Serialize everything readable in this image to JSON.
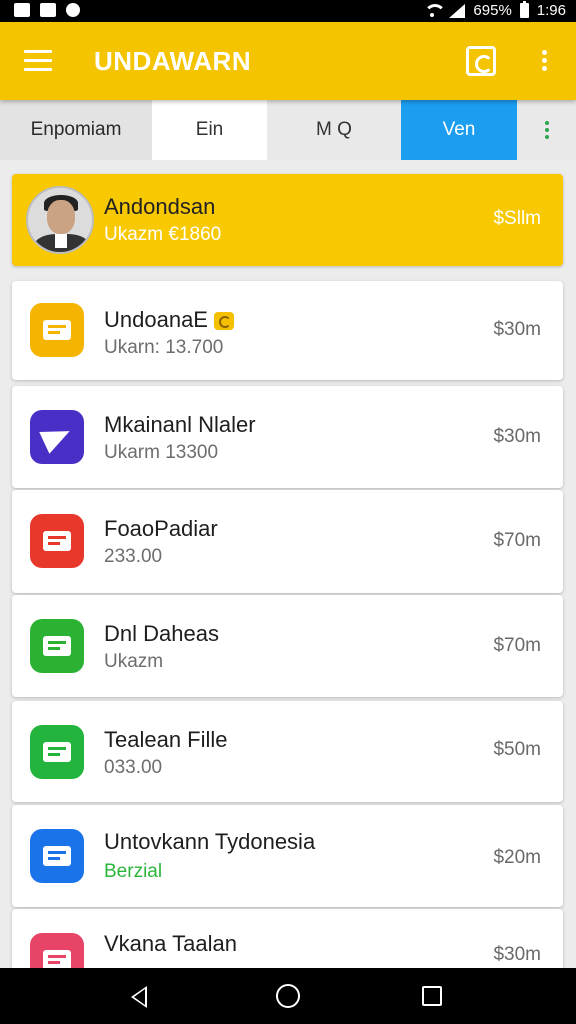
{
  "status_bar": {
    "battery_text": "695%",
    "time": "1:96"
  },
  "app_bar": {
    "title": "UNDAWARN"
  },
  "tabs": [
    {
      "label": "Enpomiam"
    },
    {
      "label": "Ein"
    },
    {
      "label": "M Q"
    },
    {
      "label": "Ven",
      "selected": true
    },
    {
      "label": "⋮"
    }
  ],
  "featured": {
    "name": "Andondsan",
    "subtitle": "Ukazm €1860",
    "price": "$Sllm"
  },
  "items": [
    {
      "title": "UndoanaE",
      "subtitle": "Ukarn: 13.700",
      "price": "$30m",
      "icon": "envelope-icon",
      "color": "#f4b400"
    },
    {
      "title": "Mkainanl Nlaler",
      "subtitle": "Ukarm 13300",
      "price": "$30m",
      "icon": "paper-plane-icon",
      "color": "#4a2fc6"
    },
    {
      "title": "FoaoPadiar",
      "subtitle": "233.00",
      "price": "$70m",
      "icon": "document-icon",
      "color": "#e8382b"
    },
    {
      "title": "Dnl Daheas",
      "subtitle": "Ukazm",
      "price": "$70m",
      "icon": "wallet-icon",
      "color": "#2bb233"
    },
    {
      "title": "Tealean Fille",
      "subtitle": "033.00",
      "price": "$50m",
      "icon": "file-icon",
      "color": "#22b43d"
    },
    {
      "title": "Untovkann Tydonesia",
      "subtitle": "Berzial",
      "price": "$20m",
      "icon": "doc-list-icon",
      "color": "#1a73e8"
    },
    {
      "title": "Vkana Taalan",
      "subtitle": "",
      "price": "$30m",
      "icon": "list-icon",
      "color": "#e84467"
    }
  ]
}
